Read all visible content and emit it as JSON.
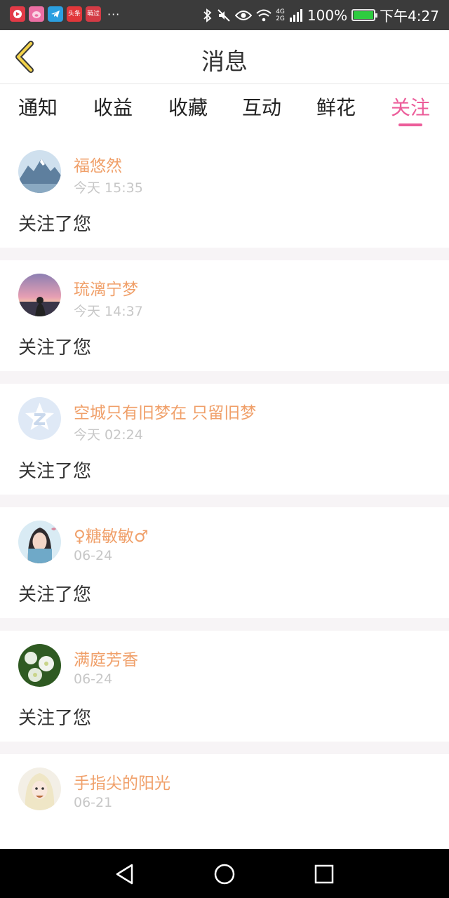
{
  "status_bar": {
    "app_icons": [
      {
        "name": "video-app-icon",
        "color": "#e23a46",
        "label": ""
      },
      {
        "name": "pig-app-icon",
        "color": "#ec6fa4",
        "label": ""
      },
      {
        "name": "telegram-app-icon",
        "color": "#2b9fe0",
        "label": ""
      },
      {
        "name": "toutiao-app-icon",
        "color": "#e1373a",
        "label": "头条"
      },
      {
        "name": "dao-app-icon",
        "color": "#d33b45",
        "label": "萌过"
      }
    ],
    "more": "···",
    "battery_text": "100%",
    "network_top": "4G",
    "network_bottom": "2G",
    "time": "下午4:27"
  },
  "header": {
    "title": "消息"
  },
  "tabs": {
    "items": [
      {
        "label": "通知"
      },
      {
        "label": "收益"
      },
      {
        "label": "收藏"
      },
      {
        "label": "互动"
      },
      {
        "label": "鲜花"
      },
      {
        "label": "关注"
      }
    ],
    "active": "关注"
  },
  "notifications": [
    {
      "name": "福悠然",
      "time": "今天 15:35",
      "action": "关注了您",
      "avatar": "mountain-avatar"
    },
    {
      "name": "琉漓宁梦",
      "time": "今天 14:37",
      "action": "关注了您",
      "avatar": "sunset-avatar"
    },
    {
      "name": "空城只有旧梦在 只留旧梦",
      "time": "今天 02:24",
      "action": "关注了您",
      "avatar": "default-avatar"
    },
    {
      "name": "♀糖敏敏♂",
      "time": "06-24",
      "action": "关注了您",
      "avatar": "girl-avatar"
    },
    {
      "name": "满庭芳香",
      "time": "06-24",
      "action": "关注了您",
      "avatar": "flower-avatar"
    },
    {
      "name": "手指尖的阳光",
      "time": "06-21",
      "action": "",
      "avatar": "anime-avatar"
    }
  ],
  "colors": {
    "accent": "#ec5d9a",
    "username": "#f0a06a",
    "status_bar": "#3b3b3b",
    "nav_bar": "#000000"
  }
}
